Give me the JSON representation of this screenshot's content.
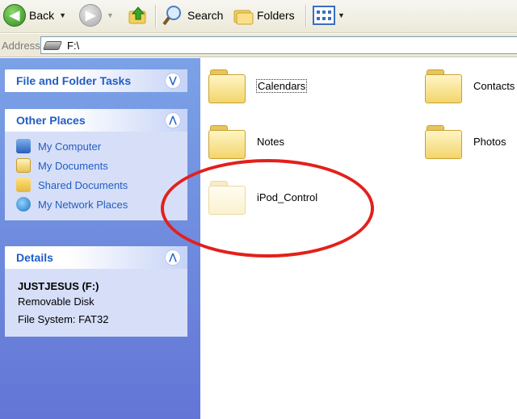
{
  "toolbar": {
    "back_label": "Back",
    "search_label": "Search",
    "folders_label": "Folders"
  },
  "address": {
    "label": "Address",
    "value": "F:\\"
  },
  "tasks": {
    "file_folder_title": "File and Folder Tasks",
    "other_places_title": "Other Places",
    "other_places": [
      {
        "label": "My Computer",
        "icon": "my-computer-icon"
      },
      {
        "label": "My Documents",
        "icon": "my-documents-icon"
      },
      {
        "label": "Shared Documents",
        "icon": "shared-documents-icon"
      },
      {
        "label": "My Network Places",
        "icon": "network-places-icon"
      }
    ],
    "details_title": "Details",
    "details": {
      "name": "JUSTJESUS (F:)",
      "type": "Removable Disk",
      "fs": "File System: FAT32"
    }
  },
  "folders": [
    {
      "name": "Calendars"
    },
    {
      "name": "Contacts"
    },
    {
      "name": "Notes"
    },
    {
      "name": "Photos"
    },
    {
      "name": "iPod_Control"
    }
  ],
  "colors": {
    "highlight_circle": "#e3201b",
    "task_title": "#215dc6"
  }
}
